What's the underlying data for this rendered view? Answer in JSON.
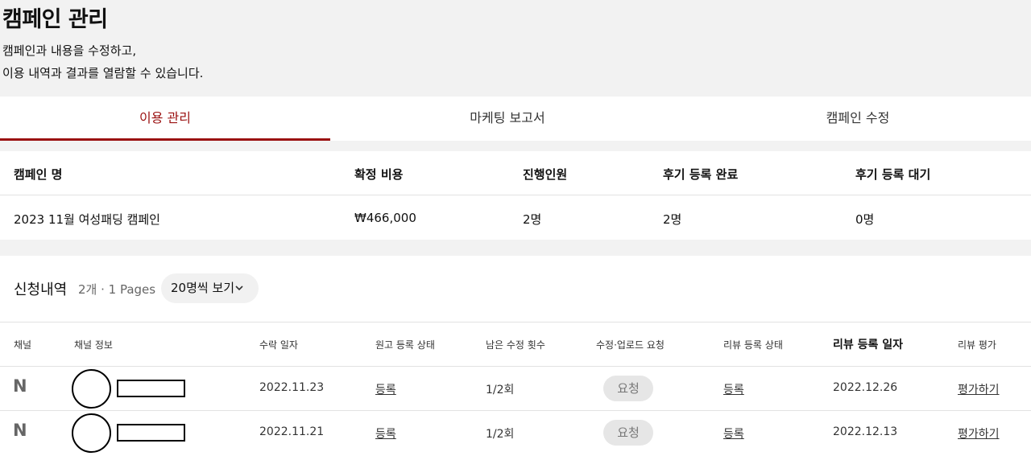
{
  "header": {
    "title": "캠페인 관리",
    "desc_line1": "캠페인과 내용을 수정하고,",
    "desc_line2": "이용 내역과 결과를 열람할 수 있습니다."
  },
  "tabs": [
    {
      "label": "이용 관리",
      "active": true
    },
    {
      "label": "마케팅 보고서",
      "active": false
    },
    {
      "label": "캠페인 수정",
      "active": false
    }
  ],
  "summary": {
    "headers": [
      "캠페인 명",
      "확정 비용",
      "진행인원",
      "후기 등록 완료",
      "후기 등록 대기"
    ],
    "values": [
      "2023 11월 여성패딩 캠페인",
      "₩466,000",
      "2명",
      "2명",
      "0명"
    ]
  },
  "list": {
    "title": "신청내역",
    "count": "2개 · 1 Pages",
    "per_page": "20명씩 보기",
    "chevron_icon": "chevron-down-icon",
    "columns": [
      "채널",
      "채널 정보",
      "수락 일자",
      "원고 등록 상태",
      "남은 수정 횟수",
      "수정·업로드 요청",
      "리뷰 등록 상태",
      "리뷰 등록 일자",
      "리뷰 평가"
    ],
    "rows": [
      {
        "channel": "N",
        "accept_date": "2022.11.23",
        "draft_status": "등록",
        "remaining": "1/2회",
        "request": "요청",
        "review_status": "등록",
        "review_date": "2022.12.26",
        "rating": "평가하기"
      },
      {
        "channel": "N",
        "accept_date": "2022.11.21",
        "draft_status": "등록",
        "remaining": "1/2회",
        "request": "요청",
        "review_status": "등록",
        "review_date": "2022.12.13",
        "rating": "평가하기"
      }
    ]
  },
  "colors": {
    "accent": "#9a1010",
    "background": "#f2f2f2",
    "panel": "#ffffff"
  }
}
